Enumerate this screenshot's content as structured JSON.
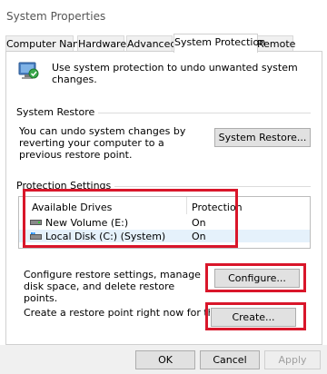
{
  "window": {
    "title": "System Properties"
  },
  "tabs": [
    {
      "label": "Computer Name"
    },
    {
      "label": "Hardware"
    },
    {
      "label": "Advanced"
    },
    {
      "label": "System Protection",
      "active": true
    },
    {
      "label": "Remote"
    }
  ],
  "intro": {
    "text": "Use system protection to undo unwanted system changes."
  },
  "system_restore": {
    "group_label": "System Restore",
    "description": "You can undo system changes by reverting your computer to a previous restore point.",
    "button_label": "System Restore..."
  },
  "protection_settings": {
    "group_label": "Protection Settings",
    "columns": [
      "Available Drives",
      "Protection"
    ],
    "drives": [
      {
        "name": "New Volume (E:)",
        "protection": "On",
        "icon": "drive-icon"
      },
      {
        "name": "Local Disk (C:) (System)",
        "protection": "On",
        "icon": "system-drive-icon",
        "selected": true
      }
    ],
    "configure_text": "Configure restore settings, manage disk space, and delete restore points.",
    "configure_button": "Configure...",
    "create_text": "Create a restore point right now for the drives that have system protection turned on.",
    "create_button": "Create..."
  },
  "footer": {
    "ok": "OK",
    "cancel": "Cancel",
    "apply": "Apply"
  },
  "colors": {
    "highlight": "#d9162a",
    "selection": "#e5f1fb"
  }
}
